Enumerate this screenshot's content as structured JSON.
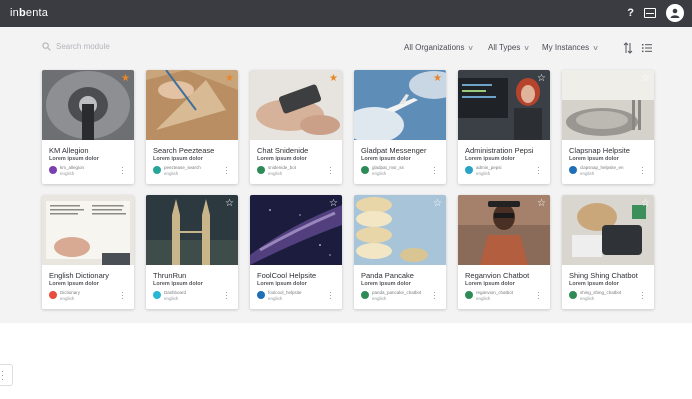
{
  "app": {
    "logo_pre": "in",
    "logo_bold": "b",
    "logo_post": "enta"
  },
  "filters": {
    "search_placeholder": "Search module",
    "organizations": "All Organizations",
    "types": "All Types",
    "instances": "My Instances"
  },
  "cards": [
    {
      "title": "KM Allegion",
      "sub": "Lorem ipsum dolor",
      "name": "km_allegion",
      "lang": "english",
      "favorite": true,
      "icon_color": "#7a3fb0"
    },
    {
      "title": "Search Peeztease",
      "sub": "Lorem ipsum dolor",
      "name": "peeztease_search",
      "lang": "english",
      "favorite": true,
      "icon_color": "#26a69a"
    },
    {
      "title": "Chat Snidenide",
      "sub": "Lorem ipsum dolor",
      "name": "snidenide_bot",
      "lang": "english",
      "favorite": true,
      "icon_color": "#2e8b57"
    },
    {
      "title": "Gladpat Messenger",
      "sub": "Lorem ipsum dolor",
      "name": "gladpat_msr_ss",
      "lang": "english",
      "favorite": true,
      "icon_color": "#2e8b57"
    },
    {
      "title": "Administration Pepsi",
      "sub": "Lorem ipsum dolor",
      "name": "admin_pepsi",
      "lang": "english",
      "favorite": false,
      "icon_color": "#29a3c8"
    },
    {
      "title": "Clapsnap Helpsite",
      "sub": "Lorem ipsum dolor",
      "name": "clapsnap_helpsite_en",
      "lang": "english",
      "favorite": false,
      "icon_color": "#1e6fb8"
    },
    {
      "title": "English Dictionary",
      "sub": "Lorem ipsum dolor",
      "name": "Dictionary",
      "lang": "english",
      "favorite": false,
      "icon_color": "#e84c3d"
    },
    {
      "title": "ThrunRun",
      "sub": "Lorem ipsum dolor",
      "name": "Dashboard",
      "lang": "english",
      "favorite": false,
      "icon_color": "#29b6d6"
    },
    {
      "title": "FoolCool Helpsite",
      "sub": "Lorem ipsum dolor",
      "name": "foolcool_helpsite",
      "lang": "english",
      "favorite": false,
      "icon_color": "#1e6fb8"
    },
    {
      "title": "Panda Pancake",
      "sub": "Lorem ipsum dolor",
      "name": "panda_pancake_chatbot",
      "lang": "english",
      "favorite": false,
      "icon_color": "#2e8b57"
    },
    {
      "title": "Reganvion Chatbot",
      "sub": "Lorem ipsum dolor",
      "name": "reganvion_chatbot",
      "lang": "english",
      "favorite": false,
      "icon_color": "#2e8b57"
    },
    {
      "title": "Shing Shing Chatbot",
      "sub": "Lorem ipsum dolor",
      "name": "shing_shing_chatbot",
      "lang": "english",
      "favorite": false,
      "icon_color": "#2e8b57"
    }
  ]
}
